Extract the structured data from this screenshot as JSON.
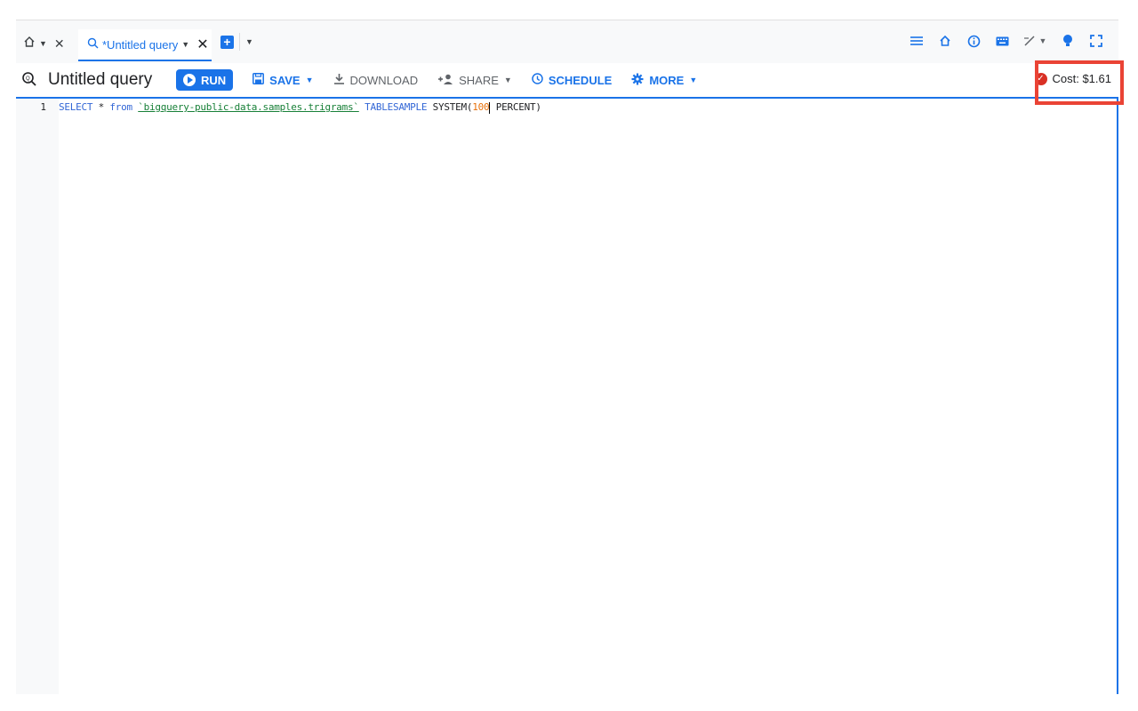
{
  "tabs": {
    "query_tab_label": "*Untitled query",
    "close_glyph": "✕"
  },
  "toolbar": {
    "title": "Untitled query",
    "run_label": "RUN",
    "save_label": "SAVE",
    "download_label": "DOWNLOAD",
    "share_label": "SHARE",
    "schedule_label": "SCHEDULE",
    "more_label": "MORE"
  },
  "cost": {
    "label": "Cost: $1.61"
  },
  "editor": {
    "line_number": "1",
    "tokens": {
      "select": "SELECT",
      "star": " * ",
      "from": "from",
      "table": "`bigquery-public-data.samples.trigrams`",
      "tablesample": "TABLESAMPLE",
      "system": "SYSTEM(",
      "number": "100",
      "percent": " PERCENT)"
    }
  },
  "colors": {
    "accent": "#1a73e8",
    "highlight": "#ea4335",
    "string": "#188038",
    "number": "#e8710a"
  },
  "icons": [
    "home-icon",
    "close-icon",
    "query-icon",
    "add-tab-icon",
    "list-icon",
    "house-icon",
    "info-icon",
    "keyboard-icon",
    "pen-icon",
    "bulb-icon",
    "fullscreen-icon",
    "save-icon",
    "download-icon",
    "share-icon",
    "schedule-icon",
    "gear-icon",
    "check-icon"
  ]
}
